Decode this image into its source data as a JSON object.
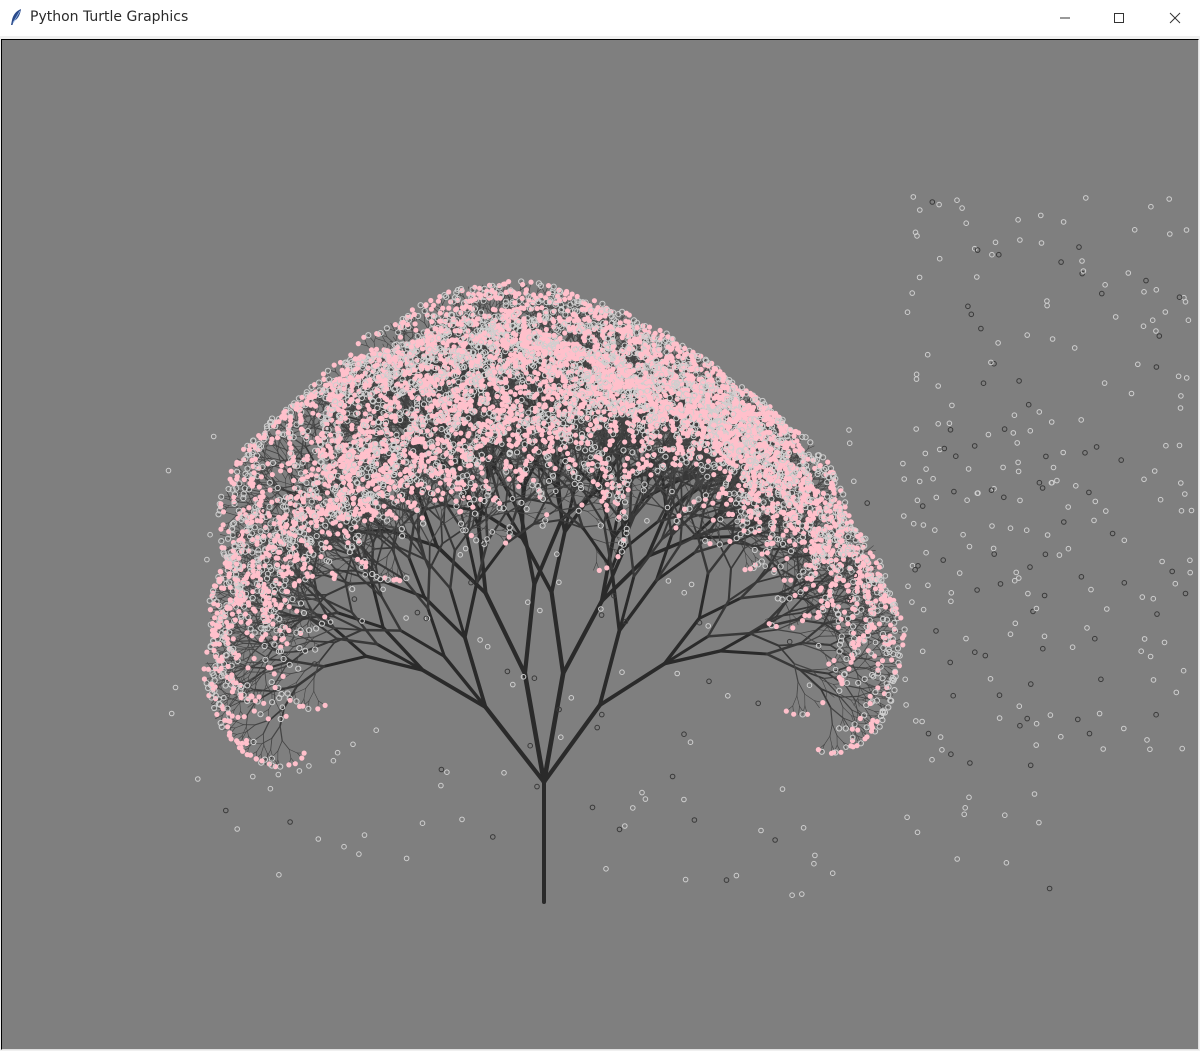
{
  "window": {
    "title": "Python Turtle Graphics",
    "controls": {
      "minimize_icon": "minimize-icon",
      "maximize_icon": "maximize-icon",
      "close_icon": "close-icon"
    }
  },
  "canvas": {
    "background_color": "#7f7f7f",
    "trunk_color": "#2a2a2a",
    "blossom_color": "#ffc0cb",
    "fallen_petal_outline_light": "#cfcfcf",
    "fallen_petal_outline_dark": "#3a3a3a"
  }
}
